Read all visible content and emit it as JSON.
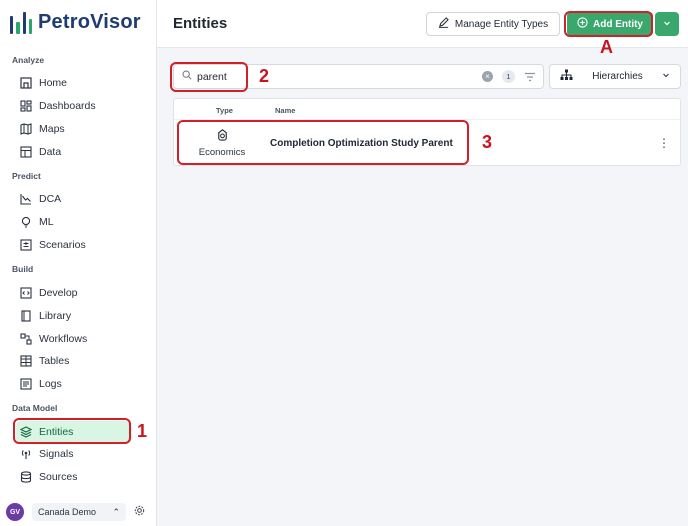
{
  "app": {
    "name": "PetroVisor"
  },
  "sidebar": {
    "sections": [
      "Analyze",
      "Predict",
      "Build",
      "Data Model"
    ],
    "items": [
      {
        "label": "Home",
        "icon": "home-icon"
      },
      {
        "label": "Dashboards",
        "icon": "dashboard-icon"
      },
      {
        "label": "Maps",
        "icon": "map-icon"
      },
      {
        "label": "Data",
        "icon": "table-icon"
      },
      {
        "label": "DCA",
        "icon": "chart-line-icon"
      },
      {
        "label": "ML",
        "icon": "lightbulb-icon"
      },
      {
        "label": "Scenarios",
        "icon": "scenarios-icon"
      },
      {
        "label": "Develop",
        "icon": "code-icon"
      },
      {
        "label": "Library",
        "icon": "library-icon"
      },
      {
        "label": "Workflows",
        "icon": "workflow-icon"
      },
      {
        "label": "Tables",
        "icon": "tables-icon"
      },
      {
        "label": "Logs",
        "icon": "logs-icon"
      },
      {
        "label": "Entities",
        "icon": "layers-icon",
        "active": true
      },
      {
        "label": "Signals",
        "icon": "signal-icon"
      },
      {
        "label": "Sources",
        "icon": "database-icon"
      }
    ],
    "footer": {
      "avatar": "GV",
      "workspace": "Canada Demo"
    }
  },
  "header": {
    "title": "Entities",
    "manage_label": "Manage Entity Types",
    "add_label": "Add Entity"
  },
  "search": {
    "value": "parent",
    "count": "1"
  },
  "hierarchies": {
    "label": "Hierarchies"
  },
  "table": {
    "columns": [
      "Type",
      "Name"
    ],
    "rows": [
      {
        "type": "Economics",
        "name": "Completion Optimization Study Parent"
      }
    ]
  },
  "annotations": {
    "one": "1",
    "two": "2",
    "three": "3",
    "a": "A"
  },
  "colors": {
    "accent": "#3aa76d",
    "brand": "#1e3c72",
    "callout": "#d1202a"
  }
}
